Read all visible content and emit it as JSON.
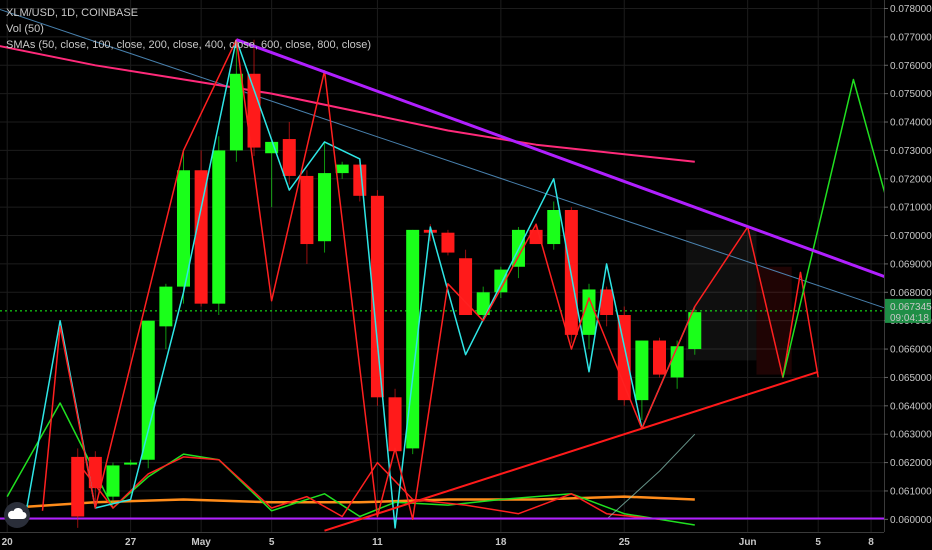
{
  "legend": {
    "title": "XLM/USD, 1D, COINBASE",
    "vol": "Vol (50)",
    "smas": "SMAs (50, close, 100, close, 200, close, 400, close, 600, close, 800, close)"
  },
  "price_label": "0.067345",
  "countdown_label": "09:04:18",
  "chart_data": {
    "type": "candlestick",
    "symbol": "XLM/USD",
    "timeframe": "1D",
    "exchange": "COINBASE",
    "ylim": [
      0.0596,
      0.0783
    ],
    "y_ticks": [
      "0.078000",
      "0.077000",
      "0.076000",
      "0.075000",
      "0.074000",
      "0.073000",
      "0.072000",
      "0.071000",
      "0.070000",
      "0.069000",
      "0.068000",
      "0.067000",
      "0.066000",
      "0.065000",
      "0.064000",
      "0.063000",
      "0.062000",
      "0.061000",
      "0.060000"
    ],
    "x_ticks": [
      {
        "label": "20",
        "i": 0
      },
      {
        "label": "27",
        "i": 7
      },
      {
        "label": "May",
        "i": 11
      },
      {
        "label": "5",
        "i": 15
      },
      {
        "label": "11",
        "i": 21
      },
      {
        "label": "18",
        "i": 28
      },
      {
        "label": "25",
        "i": 35
      },
      {
        "label": "Jun",
        "i": 42
      },
      {
        "label": "5",
        "i": 46
      },
      {
        "label": "8",
        "i": 49
      }
    ],
    "candles": [
      {
        "i": 4,
        "o": 0.0622,
        "h": 0.0625,
        "l": 0.0597,
        "c": 0.0601
      },
      {
        "i": 5,
        "o": 0.0622,
        "h": 0.0624,
        "l": 0.0604,
        "c": 0.0611
      },
      {
        "i": 6,
        "o": 0.0608,
        "h": 0.062,
        "l": 0.0606,
        "c": 0.0619
      },
      {
        "i": 7,
        "o": 0.062,
        "h": 0.0621,
        "l": 0.0619,
        "c": 0.062
      },
      {
        "i": 8,
        "o": 0.0621,
        "h": 0.067,
        "l": 0.0618,
        "c": 0.067
      },
      {
        "i": 9,
        "o": 0.0668,
        "h": 0.0683,
        "l": 0.066,
        "c": 0.0682
      },
      {
        "i": 10,
        "o": 0.0682,
        "h": 0.073,
        "l": 0.0676,
        "c": 0.0723
      },
      {
        "i": 11,
        "o": 0.0723,
        "h": 0.073,
        "l": 0.0675,
        "c": 0.0676
      },
      {
        "i": 12,
        "o": 0.0676,
        "h": 0.0735,
        "l": 0.0672,
        "c": 0.073
      },
      {
        "i": 13,
        "o": 0.073,
        "h": 0.0768,
        "l": 0.0726,
        "c": 0.0757
      },
      {
        "i": 14,
        "o": 0.0757,
        "h": 0.0769,
        "l": 0.0728,
        "c": 0.0731
      },
      {
        "i": 15,
        "o": 0.0729,
        "h": 0.0734,
        "l": 0.071,
        "c": 0.0733
      },
      {
        "i": 16,
        "o": 0.0734,
        "h": 0.074,
        "l": 0.0718,
        "c": 0.0721
      },
      {
        "i": 17,
        "o": 0.0721,
        "h": 0.0723,
        "l": 0.069,
        "c": 0.0697
      },
      {
        "i": 18,
        "o": 0.0698,
        "h": 0.0733,
        "l": 0.0694,
        "c": 0.0722
      },
      {
        "i": 19,
        "o": 0.0722,
        "h": 0.0726,
        "l": 0.072,
        "c": 0.0725
      },
      {
        "i": 20,
        "o": 0.0725,
        "h": 0.0727,
        "l": 0.0712,
        "c": 0.0714
      },
      {
        "i": 21,
        "o": 0.0714,
        "h": 0.0716,
        "l": 0.064,
        "c": 0.0643
      },
      {
        "i": 22,
        "o": 0.0643,
        "h": 0.0646,
        "l": 0.0625,
        "c": 0.0624
      },
      {
        "i": 23,
        "o": 0.0625,
        "h": 0.0702,
        "l": 0.0623,
        "c": 0.0702
      },
      {
        "i": 24,
        "o": 0.0702,
        "h": 0.0704,
        "l": 0.0698,
        "c": 0.0701
      },
      {
        "i": 25,
        "o": 0.0701,
        "h": 0.0702,
        "l": 0.0693,
        "c": 0.0694
      },
      {
        "i": 26,
        "o": 0.0692,
        "h": 0.0695,
        "l": 0.0672,
        "c": 0.0672
      },
      {
        "i": 27,
        "o": 0.0672,
        "h": 0.0682,
        "l": 0.067,
        "c": 0.068
      },
      {
        "i": 28,
        "o": 0.068,
        "h": 0.0689,
        "l": 0.0678,
        "c": 0.0688
      },
      {
        "i": 29,
        "o": 0.0689,
        "h": 0.0703,
        "l": 0.0685,
        "c": 0.0702
      },
      {
        "i": 30,
        "o": 0.0702,
        "h": 0.0704,
        "l": 0.0697,
        "c": 0.0697
      },
      {
        "i": 31,
        "o": 0.0697,
        "h": 0.0712,
        "l": 0.0695,
        "c": 0.0709
      },
      {
        "i": 32,
        "o": 0.0709,
        "h": 0.071,
        "l": 0.0662,
        "c": 0.0665
      },
      {
        "i": 33,
        "o": 0.0665,
        "h": 0.0683,
        "l": 0.066,
        "c": 0.0681
      },
      {
        "i": 34,
        "o": 0.0681,
        "h": 0.0682,
        "l": 0.0668,
        "c": 0.0672
      },
      {
        "i": 35,
        "o": 0.0672,
        "h": 0.0675,
        "l": 0.064,
        "c": 0.0642
      },
      {
        "i": 36,
        "o": 0.0642,
        "h": 0.0663,
        "l": 0.0635,
        "c": 0.0663
      },
      {
        "i": 37,
        "o": 0.0663,
        "h": 0.0664,
        "l": 0.065,
        "c": 0.0651
      },
      {
        "i": 38,
        "o": 0.065,
        "h": 0.0663,
        "l": 0.0646,
        "c": 0.0661
      },
      {
        "i": 39,
        "o": 0.066,
        "h": 0.0674,
        "l": 0.0658,
        "c": 0.0673
      }
    ],
    "zigzag_cyan": [
      [
        1,
        0.06
      ],
      [
        3,
        0.067
      ],
      [
        5,
        0.0604
      ],
      [
        7,
        0.0607
      ],
      [
        10,
        0.068
      ],
      [
        13,
        0.0769
      ],
      [
        16,
        0.0716
      ],
      [
        18,
        0.0733
      ],
      [
        20,
        0.0727
      ],
      [
        22,
        0.0597
      ],
      [
        24,
        0.0703
      ],
      [
        26,
        0.0658
      ],
      [
        31,
        0.072
      ],
      [
        33,
        0.0652
      ],
      [
        34,
        0.069
      ],
      [
        36,
        0.0632
      ],
      [
        39,
        0.0675
      ]
    ],
    "zigzag_red": [
      [
        2,
        0.0603
      ],
      [
        3,
        0.0668
      ],
      [
        5,
        0.0604
      ],
      [
        10,
        0.073
      ],
      [
        13,
        0.0769
      ],
      [
        15,
        0.0677
      ],
      [
        18,
        0.0758
      ],
      [
        21,
        0.0601
      ],
      [
        22,
        0.0625
      ],
      [
        23,
        0.06
      ],
      [
        25,
        0.0683
      ],
      [
        27,
        0.067
      ],
      [
        30,
        0.0704
      ],
      [
        32,
        0.066
      ],
      [
        33,
        0.0678
      ],
      [
        36,
        0.0632
      ],
      [
        39,
        0.0675
      ],
      [
        42,
        0.0703
      ],
      [
        44,
        0.065
      ],
      [
        45,
        0.0687
      ],
      [
        46,
        0.065
      ]
    ],
    "projection_green": [
      [
        44,
        0.065
      ],
      [
        48,
        0.0755
      ],
      [
        50,
        0.071
      ]
    ],
    "trendline_purple": [
      [
        13,
        0.0769
      ],
      [
        50,
        0.0685
      ]
    ],
    "trendline_blue": [
      [
        -2,
        0.0783
      ],
      [
        50,
        0.0674
      ]
    ],
    "trendline_support": [
      [
        18,
        0.0596
      ],
      [
        46,
        0.0652
      ]
    ],
    "ma_magenta": [
      [
        -3,
        0.077
      ],
      [
        5,
        0.076
      ],
      [
        15,
        0.075
      ],
      [
        25,
        0.0737
      ],
      [
        30,
        0.0732
      ],
      [
        39,
        0.0726
      ]
    ],
    "ma_orange": [
      [
        0,
        0.0604
      ],
      [
        5,
        0.0606
      ],
      [
        10,
        0.0607
      ],
      [
        15,
        0.0606
      ],
      [
        20,
        0.0606
      ],
      [
        25,
        0.0607
      ],
      [
        30,
        0.0607
      ],
      [
        35,
        0.0608
      ],
      [
        39,
        0.0607
      ]
    ],
    "volume_green": [
      [
        0,
        0.0608
      ],
      [
        3,
        0.0641
      ],
      [
        6,
        0.0604
      ],
      [
        8,
        0.0615
      ],
      [
        10,
        0.0623
      ],
      [
        12,
        0.0621
      ],
      [
        15,
        0.0603
      ],
      [
        18,
        0.0609
      ],
      [
        20,
        0.0601
      ],
      [
        22,
        0.0606
      ],
      [
        25,
        0.0605
      ],
      [
        28,
        0.0607
      ],
      [
        32,
        0.0609
      ],
      [
        35,
        0.0602
      ],
      [
        39,
        0.0598
      ]
    ],
    "volume_red": [
      [
        4,
        0.062
      ],
      [
        6,
        0.0604
      ],
      [
        8,
        0.0616
      ],
      [
        10,
        0.0622
      ],
      [
        12,
        0.0621
      ],
      [
        15,
        0.0604
      ],
      [
        17,
        0.0608
      ],
      [
        19,
        0.0601
      ],
      [
        21,
        0.062
      ],
      [
        23,
        0.0607
      ],
      [
        26,
        0.0605
      ],
      [
        29,
        0.0602
      ],
      [
        32,
        0.0609
      ],
      [
        34,
        0.0602
      ],
      [
        37,
        0.06
      ]
    ],
    "ma_faint": [
      [
        34,
        0.06
      ],
      [
        37,
        0.0617
      ],
      [
        39,
        0.063
      ]
    ],
    "support_level": 0.06003,
    "current_price": 0.067345,
    "projection_box": [
      38.5,
      42.5,
      0.0656,
      0.0702
    ],
    "projection_box_red": [
      42.5,
      44.5,
      0.0651,
      0.0689
    ],
    "colors": {
      "up": "#1aff1a",
      "down": "#ff1a1a",
      "cyan": "#2ee6e6",
      "purple": "#b020ff",
      "magenta": "#ff2a7a",
      "orange": "#ff8c1a",
      "blue": "#5aa0d8",
      "grid": "#1c1c1c",
      "axis_text": "#c8c8c8",
      "price_tag": "#1f8e46"
    }
  }
}
